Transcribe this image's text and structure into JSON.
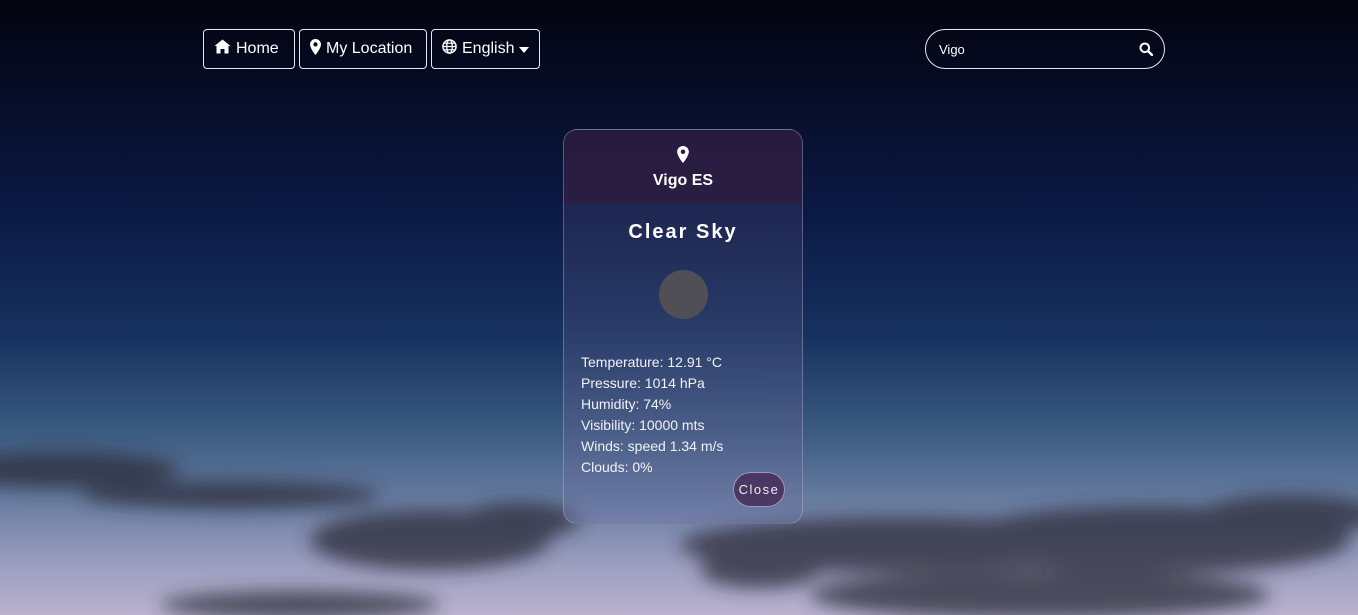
{
  "nav": {
    "home_label": "Home",
    "location_label": "My Location",
    "language_label": "English"
  },
  "search": {
    "value": "Vigo"
  },
  "card": {
    "location": "Vigo ES",
    "condition": "Clear Sky",
    "temperature": "Temperature: 12.91 °C",
    "pressure": "Pressure: 1014 hPa",
    "humidity": "Humidity: 74%",
    "visibility": "Visibility: 10000 mts",
    "winds": "Winds: speed 1.34 m/s",
    "clouds": "Clouds: 0%",
    "close_label": "Close"
  },
  "colors": {
    "card_header": "#321a3c",
    "close_button": "#462d5a",
    "icon_placeholder": "#4f4f55"
  },
  "icons": [
    "home-icon",
    "map-marker-icon",
    "globe-icon",
    "caret-down-icon",
    "search-icon"
  ]
}
